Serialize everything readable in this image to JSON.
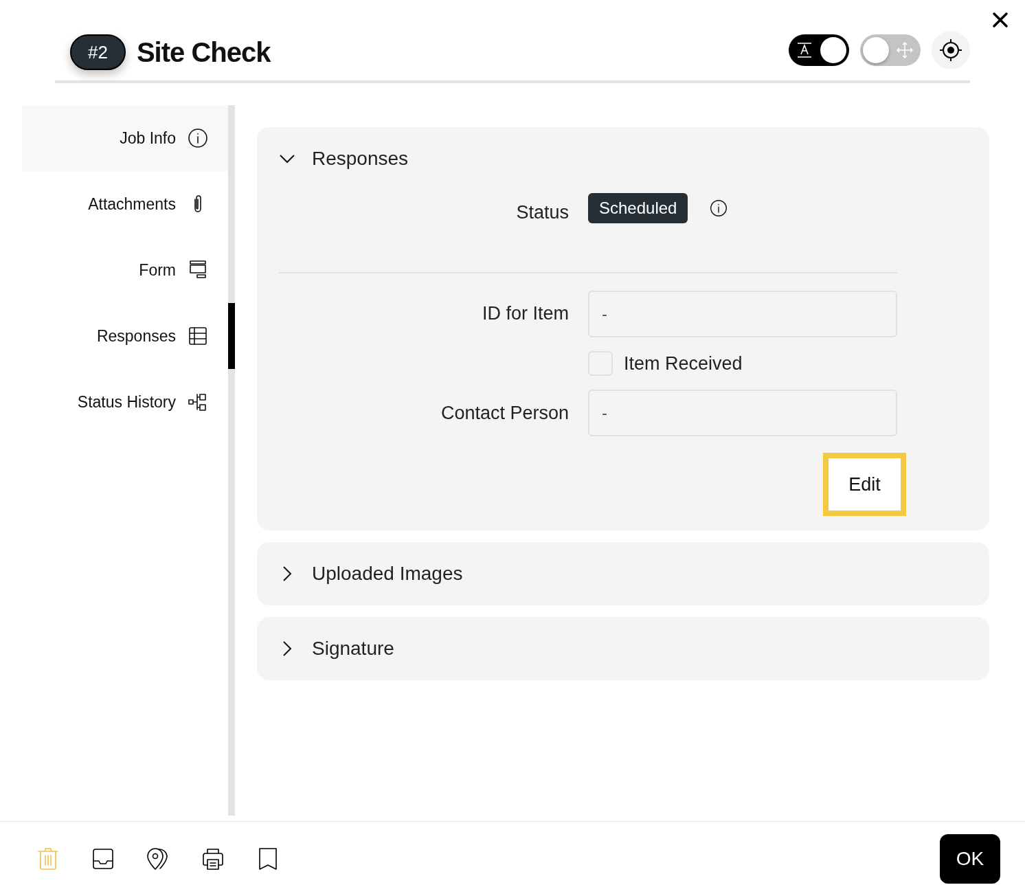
{
  "header": {
    "badge": "#2",
    "title": "Site Check",
    "toggles": [
      {
        "kind": "text",
        "on": true
      },
      {
        "kind": "move",
        "on": false
      }
    ]
  },
  "sidebar": {
    "items": [
      {
        "label": "Job Info",
        "kind": "info",
        "selected": true
      },
      {
        "label": "Attachments",
        "kind": "clip",
        "selected": false
      },
      {
        "label": "Form",
        "kind": "form",
        "selected": false
      },
      {
        "label": "Responses",
        "kind": "table",
        "selected": false
      },
      {
        "label": "Status History",
        "kind": "tree",
        "selected": false
      }
    ]
  },
  "sections": [
    {
      "title": "Responses",
      "expanded": true,
      "status_label": "Status",
      "status": "Scheduled",
      "fields": [
        {
          "kind": "input",
          "label": "ID for Item",
          "value": "-"
        },
        {
          "kind": "checkbox",
          "label": "Item Received",
          "checked": false
        },
        {
          "kind": "input",
          "label": "Contact Person",
          "value": "-"
        }
      ],
      "button": "Edit"
    },
    {
      "title": "Uploaded Images",
      "expanded": false
    },
    {
      "title": "Signature",
      "expanded": false
    }
  ],
  "footer": {
    "tools": [
      {
        "kind": "trash",
        "disabled": true
      },
      {
        "kind": "inbox",
        "disabled": false
      },
      {
        "kind": "pins",
        "disabled": false
      },
      {
        "kind": "printer",
        "disabled": false
      },
      {
        "kind": "bookmark",
        "disabled": false
      }
    ],
    "ok": "OK"
  }
}
